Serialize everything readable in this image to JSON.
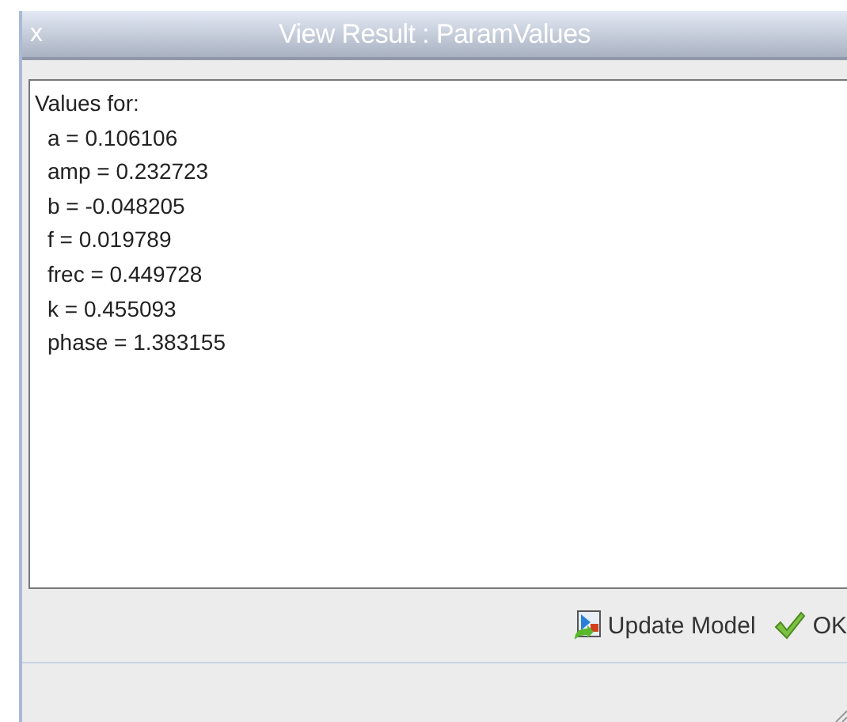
{
  "window": {
    "title": "View Result : ParamValues",
    "close": "x"
  },
  "result": {
    "heading": "Values for:",
    "lines": [
      "a = 0.106106",
      "amp = 0.232723",
      "b = -0.048205",
      "f = 0.019789",
      "frec = 0.449728",
      "k = 0.455093",
      "phase = 1.383155"
    ]
  },
  "buttons": [
    {
      "kind": "update",
      "label": "Update Model"
    },
    {
      "kind": "ok",
      "label": "OK"
    }
  ]
}
